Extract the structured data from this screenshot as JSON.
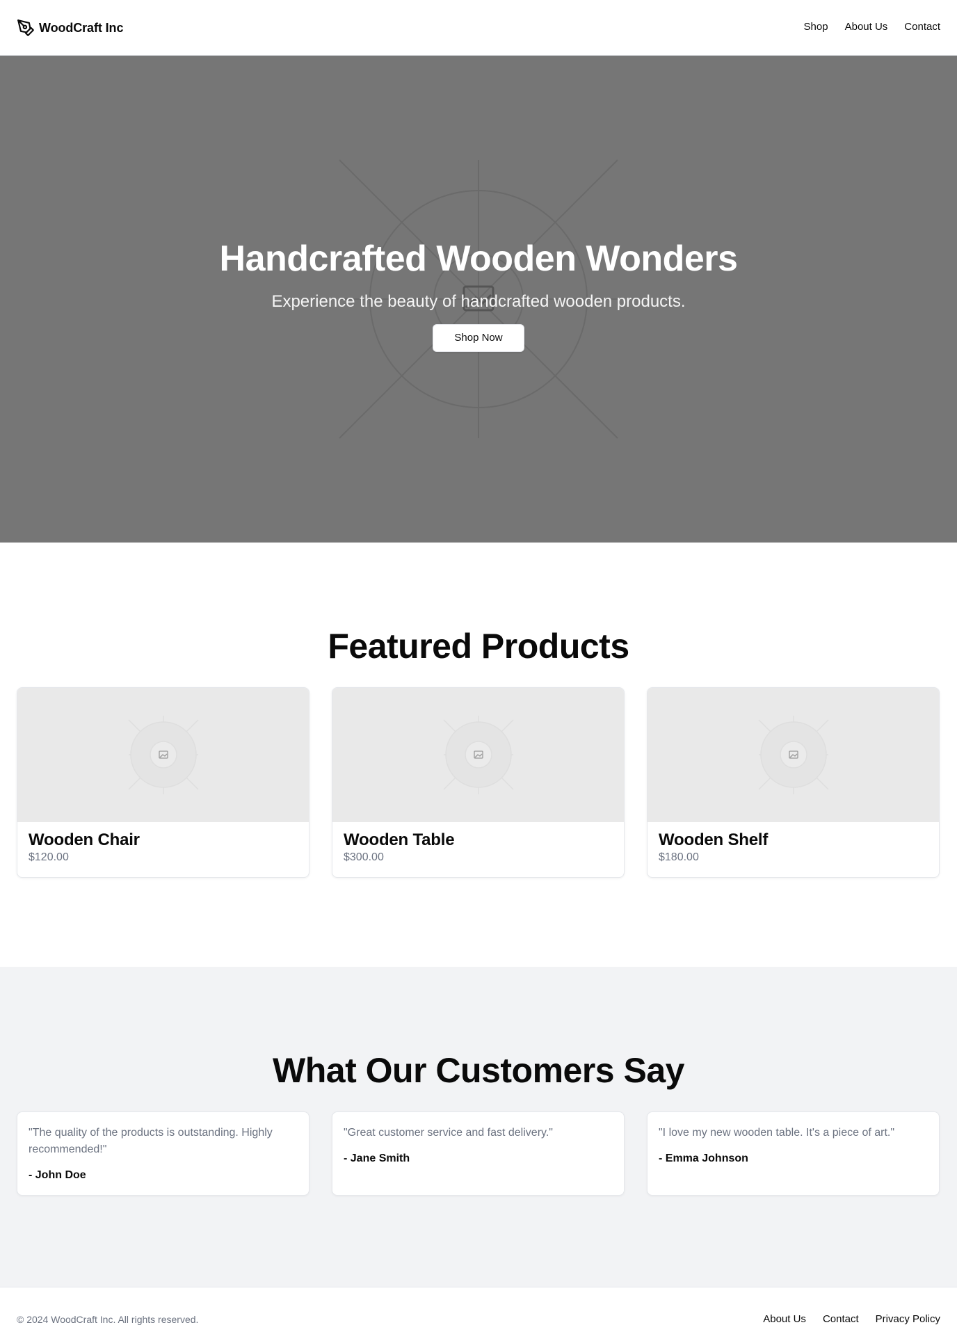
{
  "header": {
    "brand": "WoodCraft Inc",
    "logo_icon": "pen-tool-icon",
    "nav": [
      "Shop",
      "About Us",
      "Contact"
    ]
  },
  "hero": {
    "title": "Handcrafted Wooden Wonders",
    "subtitle": "Experience the beauty of handcrafted wooden products.",
    "button": "Shop Now",
    "background_color": "#767676",
    "image_icon": "image-placeholder-icon"
  },
  "featured": {
    "title": "Featured Products",
    "products": [
      {
        "name": "Wooden Chair",
        "price": "$120.00"
      },
      {
        "name": "Wooden Table",
        "price": "$300.00"
      },
      {
        "name": "Wooden Shelf",
        "price": "$180.00"
      }
    ]
  },
  "testimonials": {
    "title": "What Our Customers Say",
    "background_color": "#f2f3f5",
    "items": [
      {
        "quote": "\"The quality of the products is outstanding. Highly recommended!\"",
        "author": "- John Doe"
      },
      {
        "quote": "\"Great customer service and fast delivery.\"",
        "author": "- Jane Smith"
      },
      {
        "quote": "\"I love my new wooden table. It's a piece of art.\"",
        "author": "- Emma Johnson"
      }
    ]
  },
  "footer": {
    "copyright": "© 2024 WoodCraft Inc. All rights reserved.",
    "links": [
      "About Us",
      "Contact",
      "Privacy Policy"
    ]
  }
}
